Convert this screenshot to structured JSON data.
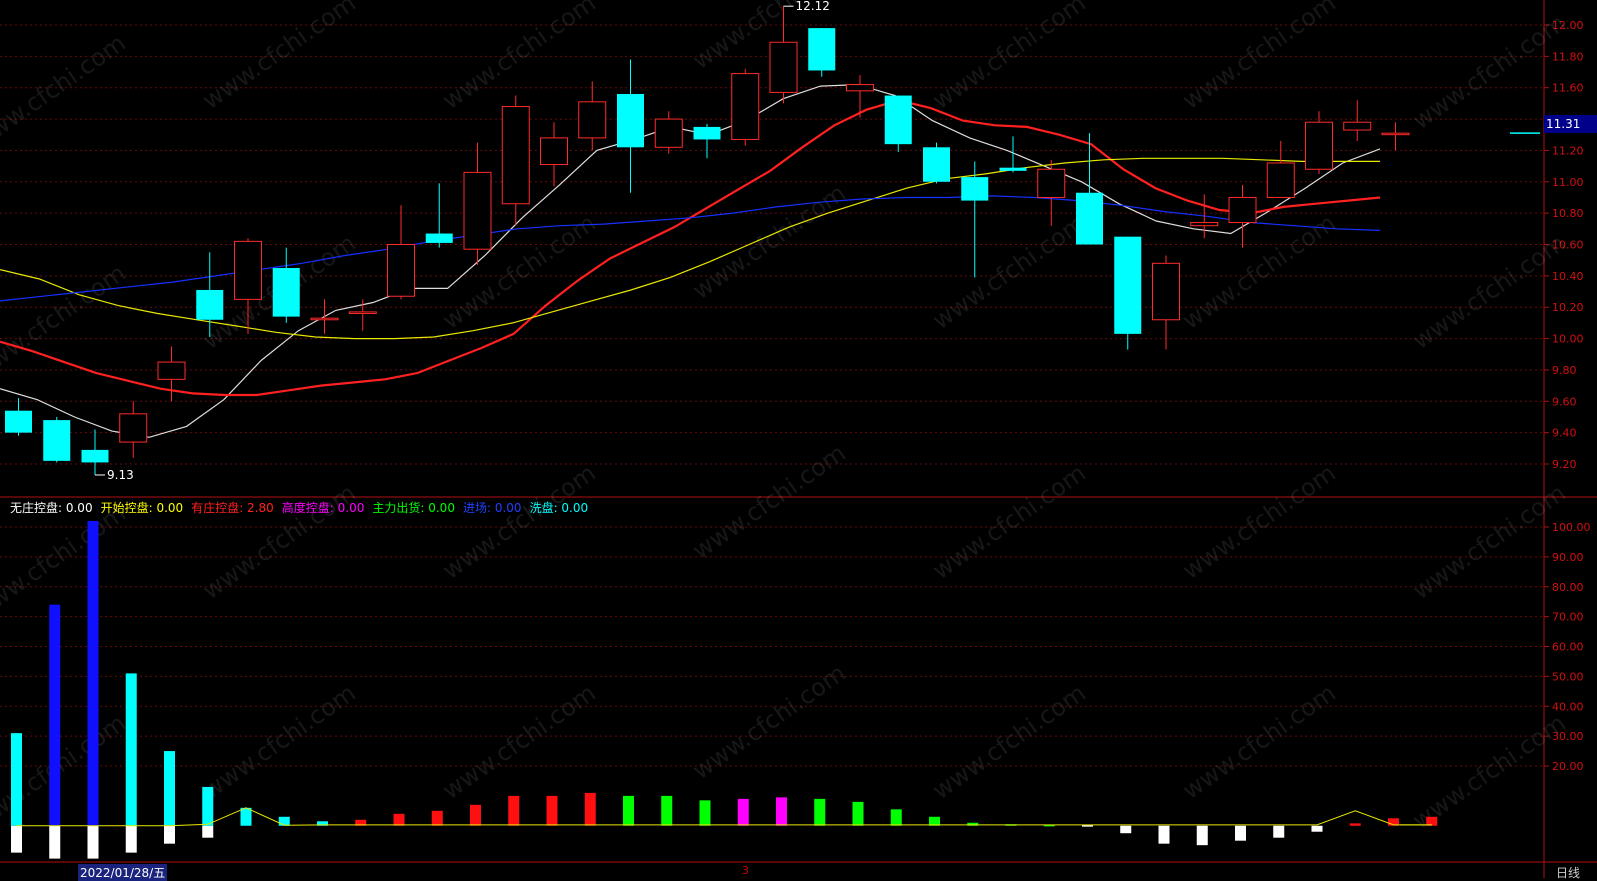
{
  "chart_data": [
    {
      "type": "candlestick",
      "ylim": [
        9.0,
        12.2
      ],
      "y_ticks": [
        "12.00",
        "11.80",
        "11.60",
        "11.40",
        "11.20",
        "11.00",
        "10.80",
        "10.60",
        "10.40",
        "10.20",
        "10.00",
        "9.80",
        "9.60",
        "9.40",
        "9.20"
      ],
      "candles": [
        {
          "o": 9.54,
          "c": 9.4,
          "h": 9.62,
          "l": 9.38
        },
        {
          "o": 9.48,
          "c": 9.22,
          "h": 9.5,
          "l": 9.21
        },
        {
          "o": 9.29,
          "c": 9.21,
          "h": 9.42,
          "l": 9.13
        },
        {
          "o": 9.34,
          "c": 9.52,
          "h": 9.6,
          "l": 9.24
        },
        {
          "o": 9.74,
          "c": 9.85,
          "h": 9.95,
          "l": 9.6
        },
        {
          "o": 10.31,
          "c": 10.12,
          "h": 10.55,
          "l": 10.01
        },
        {
          "o": 10.25,
          "c": 10.62,
          "h": 10.64,
          "l": 10.03
        },
        {
          "o": 10.45,
          "c": 10.14,
          "h": 10.58,
          "l": 10.1
        },
        {
          "o": 10.12,
          "c": 10.13,
          "h": 10.25,
          "l": 10.03
        },
        {
          "o": 10.16,
          "c": 10.17,
          "h": 10.25,
          "l": 10.05
        },
        {
          "o": 10.27,
          "c": 10.6,
          "h": 10.85,
          "l": 10.25
        },
        {
          "o": 10.67,
          "c": 10.61,
          "h": 10.99,
          "l": 10.58
        },
        {
          "o": 10.57,
          "c": 11.06,
          "h": 11.25,
          "l": 10.47
        },
        {
          "o": 10.86,
          "c": 11.48,
          "h": 11.55,
          "l": 10.72
        },
        {
          "o": 11.11,
          "c": 11.28,
          "h": 11.38,
          "l": 10.97
        },
        {
          "o": 11.28,
          "c": 11.51,
          "h": 11.64,
          "l": 11.2
        },
        {
          "o": 11.56,
          "c": 11.22,
          "h": 11.78,
          "l": 10.93
        },
        {
          "o": 11.22,
          "c": 11.4,
          "h": 11.45,
          "l": 11.18
        },
        {
          "o": 11.35,
          "c": 11.27,
          "h": 11.37,
          "l": 11.15
        },
        {
          "o": 11.27,
          "c": 11.69,
          "h": 11.72,
          "l": 11.23
        },
        {
          "o": 11.57,
          "c": 11.89,
          "h": 12.12,
          "l": 11.5
        },
        {
          "o": 11.98,
          "c": 11.71,
          "h": 11.98,
          "l": 11.67
        },
        {
          "o": 11.58,
          "c": 11.62,
          "h": 11.68,
          "l": 11.41
        },
        {
          "o": 11.55,
          "c": 11.24,
          "h": 11.55,
          "l": 11.19
        },
        {
          "o": 11.22,
          "c": 11.0,
          "h": 11.25,
          "l": 10.99
        },
        {
          "o": 11.03,
          "c": 10.88,
          "h": 11.13,
          "l": 10.39
        },
        {
          "o": 11.09,
          "c": 11.07,
          "h": 11.29,
          "l": 11.06
        },
        {
          "o": 10.9,
          "c": 11.08,
          "h": 11.14,
          "l": 10.72
        },
        {
          "o": 10.93,
          "c": 10.6,
          "h": 11.31,
          "l": 10.6
        },
        {
          "o": 10.65,
          "c": 10.03,
          "h": 10.65,
          "l": 9.93
        },
        {
          "o": 10.12,
          "c": 10.48,
          "h": 10.53,
          "l": 9.93
        },
        {
          "o": 10.72,
          "c": 10.74,
          "h": 10.92,
          "l": 10.64
        },
        {
          "o": 10.74,
          "c": 10.9,
          "h": 10.98,
          "l": 10.58
        },
        {
          "o": 10.9,
          "c": 11.12,
          "h": 11.26,
          "l": 10.9
        },
        {
          "o": 11.08,
          "c": 11.38,
          "h": 11.45,
          "l": 11.05
        },
        {
          "o": 11.33,
          "c": 11.38,
          "h": 11.52,
          "l": 11.26
        },
        {
          "o": 11.31,
          "c": 11.31,
          "h": 11.38,
          "l": 11.2
        }
      ],
      "ma_series": [
        {
          "color": "#dddddd",
          "values": [
            9.68,
            9.61,
            9.5,
            9.41,
            9.37,
            9.44,
            9.61,
            9.86,
            10.05,
            10.18,
            10.23,
            10.32,
            10.32,
            10.53,
            10.77,
            10.98,
            11.2,
            11.27,
            11.35,
            11.3,
            11.39,
            11.53,
            11.61,
            11.62,
            11.55,
            11.39,
            11.28,
            11.2,
            11.1,
            11.0,
            10.86,
            10.75,
            10.7,
            10.67,
            10.81,
            10.96,
            11.12,
            11.21
          ]
        },
        {
          "color": "#ff2020",
          "values": [
            9.98,
            9.92,
            9.85,
            9.78,
            9.73,
            9.68,
            9.65,
            9.64,
            9.64,
            9.67,
            9.7,
            9.72,
            9.74,
            9.78,
            9.86,
            9.94,
            10.03,
            10.21,
            10.37,
            10.51,
            10.61,
            10.71,
            10.83,
            10.95,
            11.07,
            11.22,
            11.36,
            11.46,
            11.52,
            11.47,
            11.39,
            11.36,
            11.35,
            11.3,
            11.24,
            11.08,
            10.96,
            10.88,
            10.82,
            10.8,
            10.84,
            10.86,
            10.88,
            10.9
          ]
        },
        {
          "color": "#e8e800",
          "values": [
            10.44,
            10.38,
            10.28,
            10.21,
            10.16,
            10.12,
            10.08,
            10.04,
            10.01,
            10.0,
            10.0,
            10.01,
            10.05,
            10.1,
            10.17,
            10.24,
            10.31,
            10.39,
            10.49,
            10.6,
            10.71,
            10.8,
            10.88,
            10.96,
            11.02,
            11.05,
            11.09,
            11.12,
            11.14,
            11.15,
            11.15,
            11.15,
            11.14,
            11.13,
            11.13,
            11.13
          ]
        },
        {
          "color": "#1530ff",
          "values": [
            10.24,
            10.27,
            10.3,
            10.33,
            10.36,
            10.4,
            10.44,
            10.48,
            10.53,
            10.57,
            10.62,
            10.66,
            10.7,
            10.72,
            10.73,
            10.75,
            10.77,
            10.8,
            10.84,
            10.87,
            10.89,
            10.9,
            10.9,
            10.91,
            10.9,
            10.88,
            10.85,
            10.81,
            10.78,
            10.74,
            10.72,
            10.7,
            10.69
          ]
        }
      ],
      "annotations": [
        {
          "text": "12.12",
          "type": "high"
        },
        {
          "text": "9.13",
          "type": "low"
        }
      ],
      "current_price": "11.31"
    },
    {
      "type": "bar",
      "ylim": [
        -10,
        102
      ],
      "y_ticks": [
        "100.00",
        "90.00",
        "80.00",
        "70.00",
        "60.00",
        "50.00",
        "40.00",
        "30.00",
        "20.00"
      ],
      "legend": [
        {
          "label": "无庄控盘:",
          "value": "0.00",
          "color": "#ffffff"
        },
        {
          "label": "开始控盘:",
          "value": "0.00",
          "color": "#ffff00"
        },
        {
          "label": "有庄控盘:",
          "value": "2.80",
          "color": "#ff2020"
        },
        {
          "label": "高度控盘:",
          "value": "0.00",
          "color": "#ff00ff"
        },
        {
          "label": "主力出货:",
          "value": "0.00",
          "color": "#00ff00"
        },
        {
          "label": "进场:",
          "value": "0.00",
          "color": "#2040ff"
        },
        {
          "label": "洗盘:",
          "value": "0.00",
          "color": "#00ffff"
        }
      ],
      "bars": [
        {
          "v": 31,
          "color": "#00ffff"
        },
        {
          "v": 74,
          "color": "#1010ff"
        },
        {
          "v": 102,
          "color": "#1010ff"
        },
        {
          "v": 51,
          "color": "#00ffff"
        },
        {
          "v": 25,
          "color": "#00ffff"
        },
        {
          "v": 13,
          "color": "#00ffff"
        },
        {
          "v": 6,
          "color": "#00ffff"
        },
        {
          "v": 3,
          "color": "#00ffff"
        },
        {
          "v": 1.5,
          "color": "#00ffff"
        },
        {
          "v": 2,
          "color": "#ff1010"
        },
        {
          "v": 4,
          "color": "#ff1010"
        },
        {
          "v": 5,
          "color": "#ff1010"
        },
        {
          "v": 7,
          "color": "#ff1010"
        },
        {
          "v": 10,
          "color": "#ff1010"
        },
        {
          "v": 10,
          "color": "#ff1010"
        },
        {
          "v": 11,
          "color": "#ff1010"
        },
        {
          "v": 10,
          "color": "#00ff00"
        },
        {
          "v": 10,
          "color": "#00ff00"
        },
        {
          "v": 8.5,
          "color": "#00ff00"
        },
        {
          "v": 9,
          "color": "#ff00ff"
        },
        {
          "v": 9.5,
          "color": "#ff00ff"
        },
        {
          "v": 9,
          "color": "#00ff00"
        },
        {
          "v": 8,
          "color": "#00ff00"
        },
        {
          "v": 5.5,
          "color": "#00ff00"
        },
        {
          "v": 3,
          "color": "#00ff00"
        },
        {
          "v": 1,
          "color": "#00ff00"
        },
        {
          "v": 0.5,
          "color": "#00ff00"
        },
        {
          "v": 0.3,
          "color": "#00ff00"
        },
        {
          "v": 0.2,
          "color": "#ffffff"
        },
        {
          "v": -2.5,
          "color": "#ffffff"
        },
        {
          "v": -6,
          "color": "#ffffff"
        },
        {
          "v": -6.5,
          "color": "#ffffff"
        },
        {
          "v": -5,
          "color": "#ffffff"
        },
        {
          "v": -4,
          "color": "#ffffff"
        },
        {
          "v": -2,
          "color": "#ffffff"
        },
        {
          "v": 0.8,
          "color": "#ff1010"
        },
        {
          "v": 2.5,
          "color": "#ff1010"
        },
        {
          "v": 3,
          "color": "#ff1010"
        }
      ],
      "negatives_lower": [
        {
          "i": 0,
          "v": -9
        },
        {
          "i": 1,
          "v": -11
        },
        {
          "i": 2,
          "v": -11
        },
        {
          "i": 3,
          "v": -9
        },
        {
          "i": 4,
          "v": -6
        },
        {
          "i": 5,
          "v": -4
        }
      ],
      "line": {
        "color": "#e8e800",
        "values": [
          0,
          0,
          0,
          0,
          0,
          0.5,
          6,
          0.2,
          0.3,
          0.3,
          0.3,
          0.3,
          0.3,
          0.3,
          0.3,
          0.3,
          0.3,
          0.3,
          0.3,
          0.3,
          0.3,
          0.3,
          0.3,
          0.3,
          0.3,
          0.3,
          0.3,
          0.3,
          0.3,
          0.3,
          0.3,
          0.3,
          0.3,
          0.3,
          0.3,
          5,
          0.3,
          0.3
        ]
      }
    }
  ],
  "footer": {
    "date": "2022/01/28/五",
    "marker": "3",
    "period": "日线"
  },
  "watermark": "www.cfchi.com"
}
